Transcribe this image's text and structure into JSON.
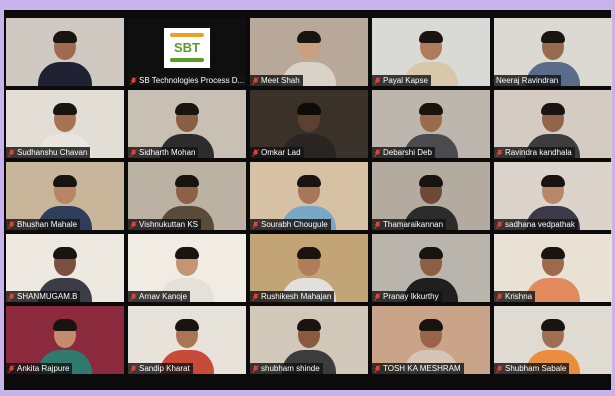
{
  "meeting": {
    "participants": [
      {
        "name": "",
        "muted": false,
        "scene": "office",
        "wall": "#cfc9c1",
        "skin": "#a06a4e",
        "shirt": "#1f2233"
      },
      {
        "name": "SB Technologies Process D...",
        "muted": true,
        "scene": "logo",
        "wall": "#0f0f0f",
        "skin": "",
        "shirt": ""
      },
      {
        "name": "Meet Shah",
        "muted": true,
        "scene": "room",
        "wall": "#b8a89a",
        "skin": "#caa083",
        "shirt": "#d9d2c6"
      },
      {
        "name": "Payal Kapse",
        "muted": true,
        "scene": "room",
        "wall": "#d9d9d6",
        "skin": "#b07b5c",
        "shirt": "#d8c7a8"
      },
      {
        "name": "Neeraj Ravindran",
        "muted": false,
        "scene": "room",
        "wall": "#dcd8d2",
        "skin": "#9a6a4e",
        "shirt": "#5a6c8a",
        "active": true
      },
      {
        "name": "Sudhanshu Chavan",
        "muted": true,
        "scene": "room",
        "wall": "#e2ddd5",
        "skin": "#a67452",
        "shirt": "#eae6df"
      },
      {
        "name": "Sidharth Mohan",
        "muted": true,
        "scene": "room",
        "wall": "#c9c0b4",
        "skin": "#8a5e42",
        "shirt": "#2c2c2c"
      },
      {
        "name": "Omkar Lad",
        "muted": true,
        "scene": "dark",
        "wall": "#3a3128",
        "skin": "#5c4030",
        "shirt": "#2a2522"
      },
      {
        "name": "Debarshi Deb",
        "muted": true,
        "scene": "room",
        "wall": "#bdb6ad",
        "skin": "#9b6a4b",
        "shirt": "#4a4a4f"
      },
      {
        "name": "Ravindra kandhala",
        "muted": true,
        "scene": "room",
        "wall": "#d4ccc2",
        "skin": "#93644a",
        "shirt": "#3c3c3c"
      },
      {
        "name": "Bhushan Mahale",
        "muted": true,
        "scene": "room",
        "wall": "#c8b59a",
        "skin": "#b98663",
        "shirt": "#2e3d5a"
      },
      {
        "name": "Vishnukuttan KS",
        "muted": true,
        "scene": "room",
        "wall": "#bcb2a4",
        "skin": "#8e6046",
        "shirt": "#5a4a3a"
      },
      {
        "name": "Sourabh Chougule",
        "muted": true,
        "scene": "room",
        "wall": "#d6c1a5",
        "skin": "#a8775a",
        "shirt": "#7aa7c4"
      },
      {
        "name": "Thamaraikannan",
        "muted": true,
        "scene": "room",
        "wall": "#b3aaa0",
        "skin": "#6e4a36",
        "shirt": "#2b2b2b"
      },
      {
        "name": "sadhana vedpathak",
        "muted": true,
        "scene": "room",
        "wall": "#dcd4ca",
        "skin": "#b88768",
        "shirt": "#3c3a48"
      },
      {
        "name": "SHANMUGAM.B",
        "muted": true,
        "scene": "room",
        "wall": "#ede8e0",
        "skin": "#7a5140",
        "shirt": "#3c3c46"
      },
      {
        "name": "Arnav Kanoje",
        "muted": true,
        "scene": "room",
        "wall": "#f0ece4",
        "skin": "#c49574",
        "shirt": "#e6e1d8"
      },
      {
        "name": "Rushikesh Mahajan",
        "muted": true,
        "scene": "room",
        "wall": "#c3a477",
        "skin": "#b07c59",
        "shirt": "#e2e0dc"
      },
      {
        "name": "Pranay Ikkurthy",
        "muted": true,
        "scene": "room",
        "wall": "#b9b4ac",
        "skin": "#8c5e44",
        "shirt": "#1f1f1f"
      },
      {
        "name": "Krishna",
        "muted": true,
        "scene": "room",
        "wall": "#e9e1d3",
        "skin": "#9e6a4c",
        "shirt": "#e08a5e"
      },
      {
        "name": "Ankita Rajpure",
        "muted": true,
        "scene": "room",
        "wall": "#8a2a3c",
        "skin": "#c48c6c",
        "shirt": "#2e7a6e"
      },
      {
        "name": "Sandip Kharat",
        "muted": true,
        "scene": "room",
        "wall": "#e7e2da",
        "skin": "#a97556",
        "shirt": "#c84b3a"
      },
      {
        "name": "shubham shinde",
        "muted": true,
        "scene": "room",
        "wall": "#d2c8ba",
        "skin": "#8a5a40",
        "shirt": "#3c3c3c"
      },
      {
        "name": "TOSH KA MESHRAM",
        "muted": true,
        "scene": "room",
        "wall": "#c9a488",
        "skin": "#9a6448",
        "shirt": "#d6c4b6"
      },
      {
        "name": "Shubham Sabale",
        "muted": true,
        "scene": "room",
        "wall": "#e0dbd2",
        "skin": "#a06e50",
        "shirt": "#e88e3c"
      }
    ],
    "colors": {
      "accent_outline": "#d6e34a",
      "mic_muted": "#e0453a",
      "frame": "#c8b4ea"
    },
    "logo_text": "SBT"
  }
}
